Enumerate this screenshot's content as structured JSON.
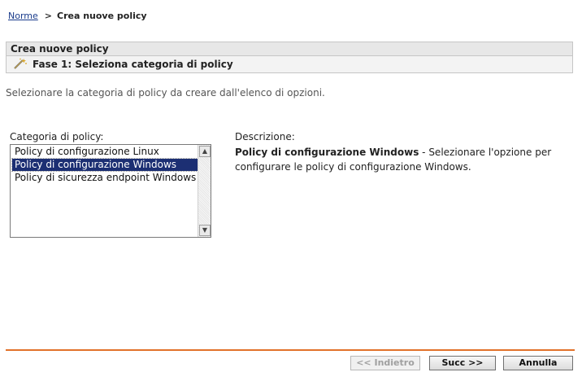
{
  "breadcrumb": {
    "root": "Norme",
    "separator": ">",
    "current": "Crea nuove policy"
  },
  "panel": {
    "title": "Crea nuove policy"
  },
  "step": {
    "title": "Fase 1: Seleziona categoria di policy",
    "icon": "wand-icon"
  },
  "instruction": "Selezionare la categoria di policy da creare dall'elenco di opzioni.",
  "category": {
    "label": "Categoria di policy:",
    "options": [
      "Policy di configurazione Linux",
      "Policy di configurazione Windows",
      "Policy di sicurezza endpoint Windows"
    ],
    "selected_index": 1
  },
  "description": {
    "label": "Descrizione:",
    "title": "Policy di configurazione Windows",
    "text": " - Selezionare l'opzione per configurare le policy di configurazione Windows."
  },
  "buttons": {
    "back": "<< Indietro",
    "next": "Succ >>",
    "cancel": "Annulla"
  },
  "colors": {
    "divider": "#e2722a",
    "selection": "#1c2f73",
    "link": "#1a3c8c"
  }
}
